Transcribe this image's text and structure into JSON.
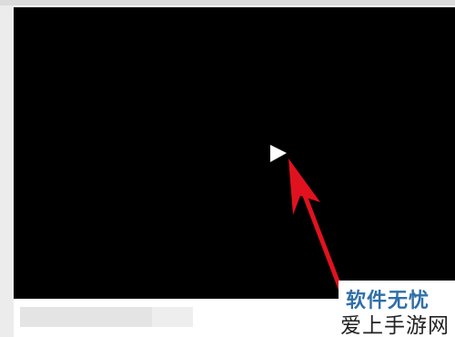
{
  "player": {
    "play_icon": "play-triangle-icon",
    "play_icon_color": "#ffffff",
    "background_color": "#000000"
  },
  "annotation": {
    "arrow_color": "#e0121f"
  },
  "watermark": {
    "line1": "软件无忧",
    "line2": "爱上手游网",
    "line1_color": "#2f6fa8",
    "line2_color": "#222222"
  }
}
